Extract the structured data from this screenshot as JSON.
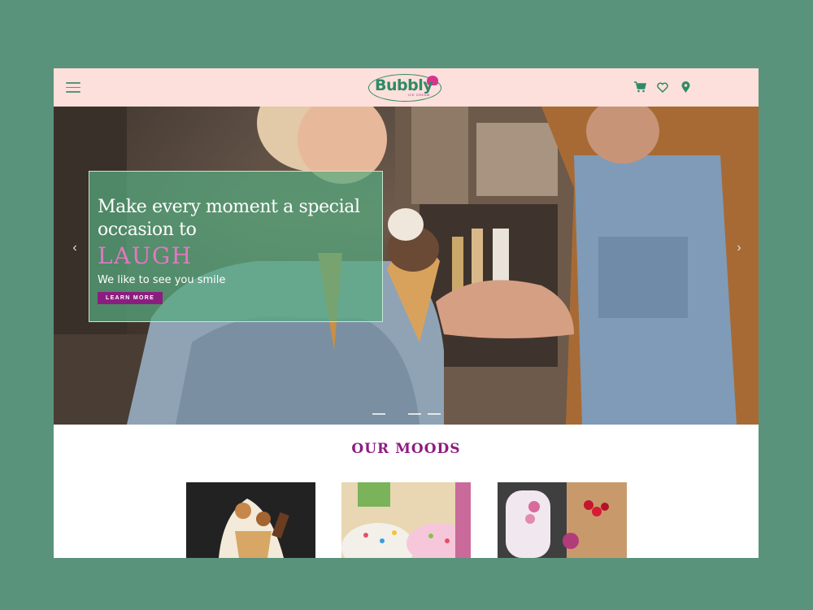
{
  "header": {
    "brand": "Bubbly",
    "brand_sub": "ICE CREAM",
    "icons": [
      "menu-icon",
      "cart-icon",
      "heart-icon",
      "location-pin-icon"
    ]
  },
  "hero": {
    "headline": "Make every moment a special occasion to",
    "keyword": "LAUGH",
    "tagline": "We like to see you smile",
    "cta_label": "LEARN MORE",
    "slide_count": 3,
    "active_slide": 1
  },
  "moods": {
    "title": "OUR MOODS",
    "cards": [
      {
        "name": "mood-card-sundae"
      },
      {
        "name": "mood-card-sprinkles"
      },
      {
        "name": "mood-card-popsicle"
      }
    ]
  },
  "colors": {
    "page_bg": "#5a937c",
    "header_bg": "#fde0db",
    "brand_green": "#2f8a66",
    "accent_purple": "#8c1d80",
    "accent_pink": "#e377c2",
    "hero_box": "#56aa80"
  }
}
